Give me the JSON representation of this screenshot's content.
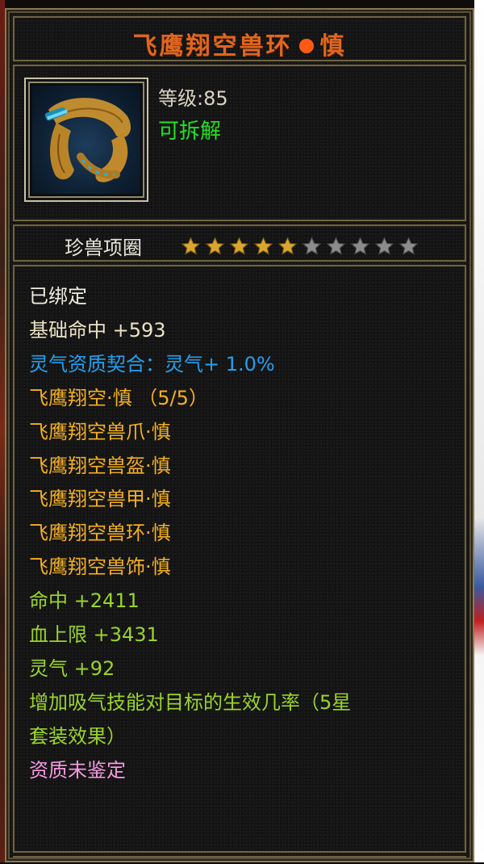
{
  "item": {
    "name": "飞鹰翔空兽环",
    "suffix": "慎",
    "level_label": "等级:85",
    "dismantle": "可拆解",
    "category": "珍兽项圈",
    "stars_filled": 5,
    "stars_total": 10,
    "icon": "feather-ring-icon"
  },
  "attributes": [
    {
      "text": "已绑定",
      "color": "white"
    },
    {
      "text": "基础命中 +593",
      "color": "beige"
    },
    {
      "text": "灵气资质契合：灵气+ 1.0%",
      "color": "cyan"
    },
    {
      "text": "飞鹰翔空·慎 （5/5）",
      "color": "yellow"
    },
    {
      "text": "飞鹰翔空兽爪·慎",
      "color": "yellow"
    },
    {
      "text": "飞鹰翔空兽盔·慎",
      "color": "yellow"
    },
    {
      "text": "飞鹰翔空兽甲·慎",
      "color": "yellow"
    },
    {
      "text": "飞鹰翔空兽环·慎",
      "color": "yellow"
    },
    {
      "text": "飞鹰翔空兽饰·慎",
      "color": "yellow"
    },
    {
      "text": "命中 +2411",
      "color": "green"
    },
    {
      "text": "血上限 +3431",
      "color": "green"
    },
    {
      "text": "灵气 +92",
      "color": "green"
    },
    {
      "text": "增加吸气技能对目标的生效几率（5星",
      "color": "green"
    },
    {
      "text": "套装效果）",
      "color": "green"
    },
    {
      "text": "资质未鉴定",
      "color": "pink"
    }
  ],
  "colors": {
    "title": "#e0661e",
    "frame": "#8a7a52",
    "white": "#f0ece0",
    "beige": "#ebe2c4",
    "cyan": "#22a0f0",
    "yellow": "#f4b020",
    "green": "#9ad42a",
    "pink": "#f59ae0",
    "dismantle": "#22e022"
  }
}
